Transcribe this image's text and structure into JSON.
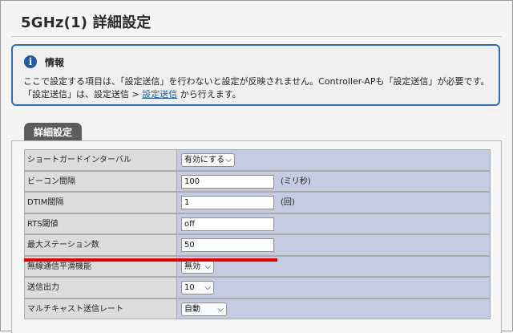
{
  "page": {
    "title": "5GHz(1) 詳細設定"
  },
  "info": {
    "icon": "info-icon",
    "icon_glyph": "i",
    "title": "情報",
    "line1": "ここで設定する項目は、「設定送信」を行わないと設定が反映されません。Controller-APも「設定送信」が必要です。",
    "line2_prefix": "「設定送信」は、設定送信 > ",
    "line2_link": "設定送信",
    "line2_suffix": " から行えます。"
  },
  "tab": {
    "label": "詳細設定"
  },
  "settings": {
    "guard_interval": {
      "label": "ショートガードインターバル",
      "value": "有効にする"
    },
    "beacon": {
      "label": "ビーコン間隔",
      "value": "100",
      "unit": "(ミリ秒)"
    },
    "dtim": {
      "label": "DTIM間隔",
      "value": "1",
      "unit": "(回)"
    },
    "rts": {
      "label": "RTS閾値",
      "value": "off"
    },
    "max_stations": {
      "label": "最大ステーション数",
      "value": "50"
    },
    "wireless_smoothing": {
      "label": "無線通信平滑機能",
      "value": "無効"
    },
    "tx_power": {
      "label": "送信出力",
      "value": "10"
    },
    "multicast_rate": {
      "label": "マルチキャスト送信レート",
      "value": "自動"
    }
  },
  "icons": {
    "chevron": "chevron-down-icon",
    "chevron_glyph": "⌵"
  },
  "colors": {
    "info_border": "#2d6db4",
    "link": "#1f5aa5",
    "value_cell": "#c7cbe2",
    "highlight": "#e00000"
  }
}
